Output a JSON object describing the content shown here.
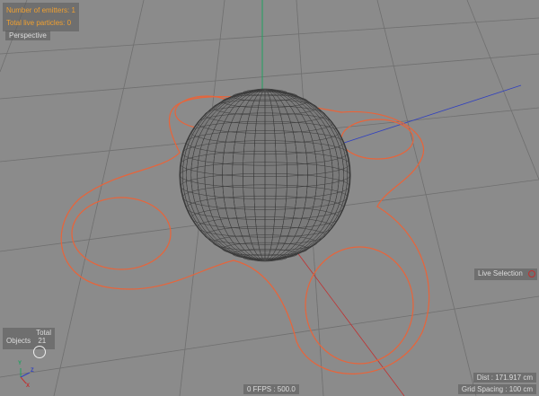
{
  "hud": {
    "emitters": "Number of emitters: 1",
    "particles": "Total live particles: 0",
    "view_name": "Perspective"
  },
  "stats": {
    "header": "Total",
    "row_label": "Objects",
    "row_value": "21"
  },
  "tool": {
    "label": "Live Selection"
  },
  "status": {
    "fps": "0 FFPS : 500.0",
    "dist": "Dist : 171.917 cm",
    "grid": "Grid Spacing : 100 cm"
  },
  "axes": {
    "x": "X",
    "y": "Y",
    "z": "Z"
  },
  "colors": {
    "background": "#8b8b8b",
    "spline": "#e8643a",
    "x_axis": "#c03030",
    "y_axis": "#20a060",
    "z_axis": "#3040c0",
    "hud_text": "#f0a030"
  }
}
